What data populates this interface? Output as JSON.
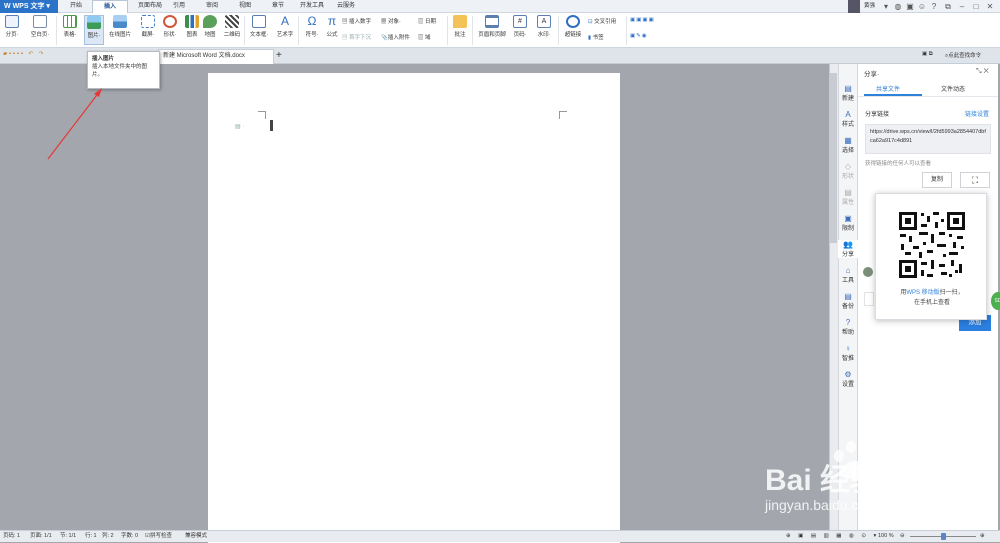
{
  "app": {
    "name": "WPS 文字"
  },
  "menu_tabs": [
    {
      "label": "开始",
      "active": false
    },
    {
      "label": "插入",
      "active": true
    },
    {
      "label": "页面布局",
      "active": false
    },
    {
      "label": "引用",
      "active": false
    },
    {
      "label": "审阅",
      "active": false
    },
    {
      "label": "视图",
      "active": false
    },
    {
      "label": "章节",
      "active": false
    },
    {
      "label": "开发工具",
      "active": false
    },
    {
      "label": "云服务",
      "active": false
    }
  ],
  "user": {
    "name": "黄强"
  },
  "ribbon": {
    "items": [
      {
        "label": "分页·",
        "icon": "page-break-icon",
        "color": "#5b7fb5"
      },
      {
        "label": "空白页·",
        "icon": "blank-page-icon",
        "color": "#7c8ea6"
      },
      {
        "label": "表格·",
        "icon": "table-icon",
        "color": "#4e9a4a"
      },
      {
        "label": "图片·",
        "icon": "picture-icon",
        "color": "#3d9c58"
      },
      {
        "label": "在线图片",
        "icon": "online-picture-icon",
        "color": "#4a8ac9"
      },
      {
        "label": "截屏·",
        "icon": "screenshot-icon",
        "color": "#3f7fcb"
      },
      {
        "label": "形状·",
        "icon": "shape-icon",
        "color": "#d1573a"
      },
      {
        "label": "图表",
        "icon": "chart-icon",
        "color": "#3e8d48"
      },
      {
        "label": "地图",
        "icon": "map-icon",
        "color": "#d04a4a"
      },
      {
        "label": "二维码",
        "icon": "qrcode-icon",
        "color": "#444"
      },
      {
        "label": "文本框·",
        "icon": "textbox-icon",
        "color": "#5a7fb0"
      },
      {
        "label": "艺术字",
        "icon": "wordart-icon",
        "color": "#2f6fc2"
      },
      {
        "label": "符号·",
        "icon": "symbol-icon",
        "color": "#2f6fc2"
      },
      {
        "label": "公式",
        "icon": "formula-icon",
        "color": "#2f6fc2"
      }
    ],
    "small_items": [
      {
        "label": "插入数字"
      },
      {
        "label": "对象·"
      },
      {
        "label": "日期"
      },
      {
        "label": "首字下沉"
      },
      {
        "label": "插入附件"
      },
      {
        "label": "域"
      }
    ],
    "items2": [
      {
        "label": "批注",
        "icon": "comment-icon",
        "color": "#e0a22b"
      },
      {
        "label": "页眉和页脚",
        "icon": "header-footer-icon",
        "color": "#5a7fb0"
      },
      {
        "label": "页码·",
        "icon": "page-number-icon",
        "color": "#5a7fb0"
      },
      {
        "label": "水印·",
        "icon": "watermark-icon",
        "color": "#5a7fb0"
      },
      {
        "label": "超链接",
        "icon": "hyperlink-icon",
        "color": "#2f6fc2"
      }
    ],
    "cross_ref": "交叉引用",
    "bookmark": "书签"
  },
  "doc_tab": {
    "title": "新建 Microsoft Word 文档.docx"
  },
  "search_cmd": "点此查找命令",
  "tooltip": {
    "title": "插入图片",
    "body": "插入本地文件夹中的图片。"
  },
  "sidebar": [
    {
      "label": "新建",
      "icon": "new-doc-icon"
    },
    {
      "label": "样式",
      "icon": "style-icon"
    },
    {
      "label": "选择",
      "icon": "select-icon"
    },
    {
      "label": "形状",
      "icon": "shape-panel-icon"
    },
    {
      "label": "属性",
      "icon": "property-icon"
    },
    {
      "label": "限制",
      "icon": "restrict-icon"
    },
    {
      "label": "分享",
      "icon": "share-icon"
    },
    {
      "label": "工具",
      "icon": "tools-icon"
    },
    {
      "label": "备份",
      "icon": "backup-icon"
    },
    {
      "label": "帮助",
      "icon": "help-icon"
    },
    {
      "label": "智推",
      "icon": "smart-push-icon"
    },
    {
      "label": "设置",
      "icon": "settings-icon"
    }
  ],
  "share_panel": {
    "title": "分享·",
    "tab_share": "共享文件",
    "tab_activity": "文件动态",
    "link_label": "分享链接",
    "link_settings": "链接设置",
    "link_url": "https://drive.wps.cn/view/l/2fd5993a2854407dbfca62a917c4d891",
    "access_note": "获得链接的任何人可以查看",
    "copy_button": "复制",
    "add_button": "添加",
    "qr_caption_prefix": "用",
    "qr_caption_link": "WPS 移动版",
    "qr_caption_suffix": "扫一扫，",
    "qr_caption_line2": "在手机上查看"
  },
  "status": {
    "page_no": "页码: 1",
    "pages": "页面: 1/1",
    "section": "节: 1/1",
    "row": "行: 1",
    "col": "列: 2",
    "words": "字数: 0",
    "spellcheck": "拼写检查",
    "compat": "兼容模式",
    "zoom": "100 %"
  },
  "watermark": {
    "brand": "Bai 经验",
    "url": "jingyan.baidu.com"
  },
  "colors": {
    "accent": "#2b73c9",
    "arrow": "#e53935",
    "link": "#2f82d9",
    "button": "#2b7fe0"
  }
}
